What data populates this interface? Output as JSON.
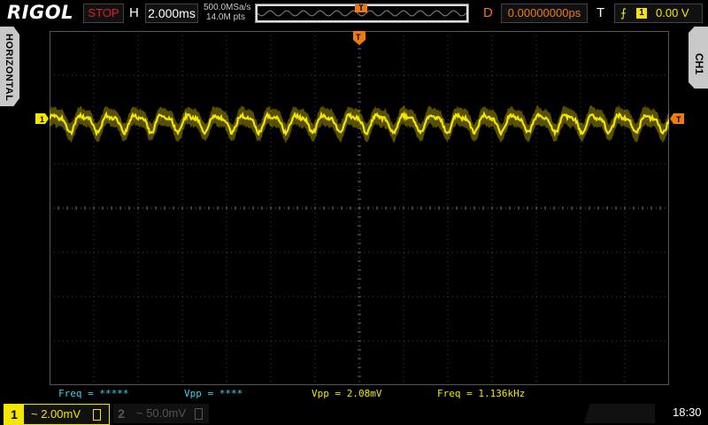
{
  "header": {
    "brand": "RIGOL",
    "run_state": "STOP",
    "h_label": "H",
    "timebase": "2.000ms",
    "sample_rate": "500.0MSa/s",
    "memory_depth": "14.0M pts",
    "trigger_marker": "T",
    "delay_label": "D",
    "delay_value": "0.00000000ps",
    "trigger_label": "T",
    "trigger_source": "1",
    "trigger_level": "0.00 V"
  },
  "side": {
    "left_tab": "HORIZONTAL",
    "right_tab": "CH1"
  },
  "screen": {
    "ch1_marker": "1",
    "trigger_level_marker": "T",
    "trigger_position_marker": "T",
    "waveform_color": "#f5e600",
    "waveform_cycles": 23
  },
  "measurements": {
    "freq_ch1": "Freq = *****",
    "vpp_ch1": "Vpp = ****",
    "vpp": "Vpp = 2.08mV",
    "freq": "Freq = 1.136kHz"
  },
  "channels": {
    "ch1_number": "1",
    "ch1_scale": "~ 2.00mV",
    "ch2_number": "2",
    "ch2_scale": "~ 50.0mV"
  },
  "clock": "18:30",
  "colors": {
    "accent_orange": "#f07a10",
    "ch1_yellow": "#f5e600",
    "cyan": "#39d3e6",
    "stop_red": "#e02020"
  }
}
